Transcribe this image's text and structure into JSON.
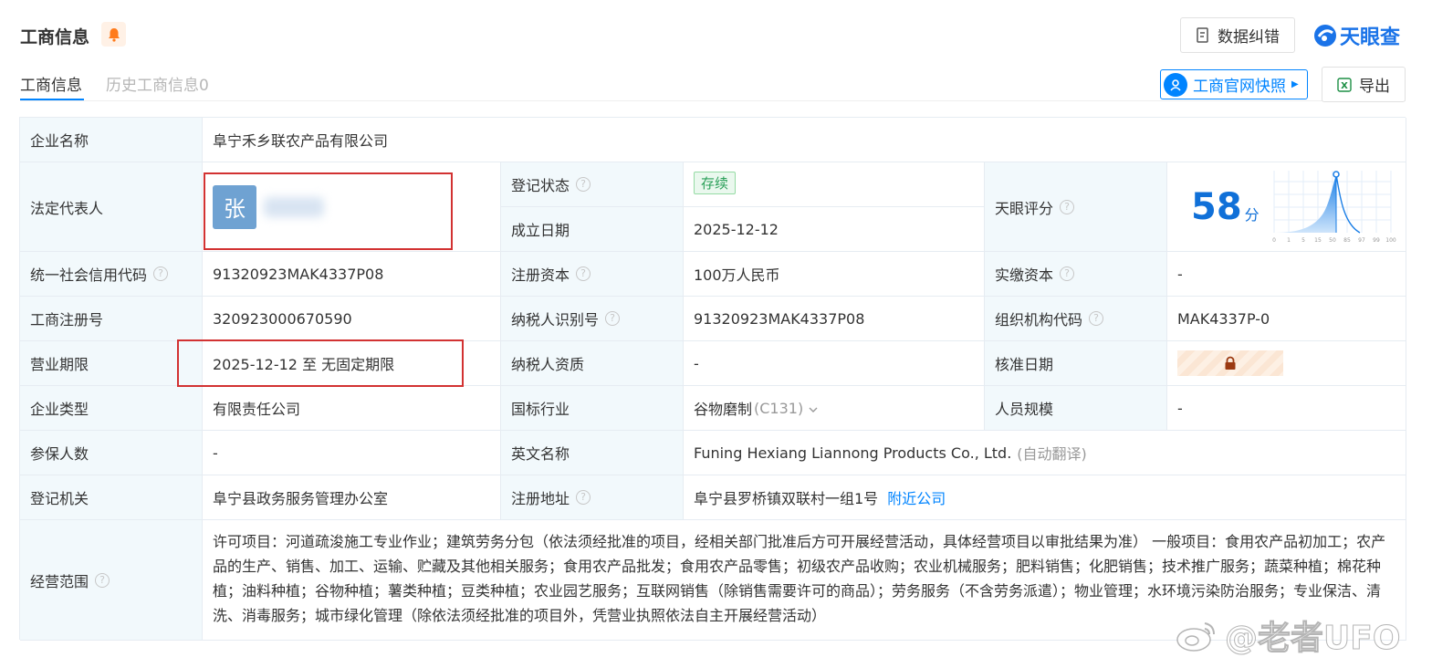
{
  "header": {
    "title": "工商信息",
    "correction_label": "数据纠错",
    "logo_text": "天眼查",
    "snapshot_label": "工商官网快照",
    "export_label": "导出",
    "bell_color": "#ff7a1a",
    "accent_color": "#0084ff"
  },
  "tabs": [
    {
      "label": "工商信息",
      "active": true
    },
    {
      "label": "历史工商信息0",
      "active": false
    }
  ],
  "table": {
    "company_name_label": "企业名称",
    "company_name": "阜宁禾乡联农产品有限公司",
    "legal_rep_label": "法定代表人",
    "legal_rep_avatar_char": "张",
    "reg_status_label": "登记状态",
    "reg_status": "存续",
    "founded_label": "成立日期",
    "founded": "2025-12-12",
    "score_label": "天眼评分",
    "score": "58",
    "score_unit": "分",
    "score_axis": [
      "0",
      "1",
      "5",
      "15",
      "50",
      "85",
      "97",
      "99",
      "100"
    ],
    "credit_code_label": "统一社会信用代码",
    "credit_code": "91320923MAK4337P08",
    "reg_capital_label": "注册资本",
    "reg_capital": "100万人民币",
    "paid_capital_label": "实缴资本",
    "paid_capital": "-",
    "biz_reg_no_label": "工商注册号",
    "biz_reg_no": "320923000670590",
    "taxpayer_id_label": "纳税人识别号",
    "taxpayer_id": "91320923MAK4337P08",
    "org_code_label": "组织机构代码",
    "org_code": "MAK4337P-0",
    "term_label": "营业期限",
    "term": "2025-12-12 至 无固定期限",
    "taxpayer_qual_label": "纳税人资质",
    "taxpayer_qual": "-",
    "approval_date_label": "核准日期",
    "company_type_label": "企业类型",
    "company_type": "有限责任公司",
    "industry_label": "国标行业",
    "industry": "谷物磨制",
    "industry_code": "(C131)",
    "staff_size_label": "人员规模",
    "staff_size": "-",
    "insured_label": "参保人数",
    "insured": "-",
    "english_name_label": "英文名称",
    "english_name": "Funing Hexiang Liannong Products Co., Ltd.",
    "auto_translate": "(自动翻译)",
    "reg_authority_label": "登记机关",
    "reg_authority": "阜宁县政务服务管理办公室",
    "reg_address_label": "注册地址",
    "reg_address": "阜宁县罗桥镇双联村一组1号",
    "nearby_link": "附近公司",
    "scope_label": "经营范围",
    "scope": "许可项目：河道疏浚施工专业作业；建筑劳务分包（依法须经批准的项目，经相关部门批准后方可开展经营活动，具体经营项目以审批结果为准） 一般项目：食用农产品初加工；农产品的生产、销售、加工、运输、贮藏及其他相关服务；食用农产品批发；食用农产品零售；初级农产品收购；农业机械服务；肥料销售；化肥销售；技术推广服务；蔬菜种植；棉花种植；油料种植；谷物种植；薯类种植；豆类种植；农业园艺服务；互联网销售（除销售需要许可的商品）；劳务服务（不含劳务派遣）；物业管理；水环境污染防治服务；专业保洁、清洗、消毒服务；城市绿化管理（除依法须经批准的项目外，凭营业执照依法自主开展经营活动）"
  },
  "watermark": "@老者UFO"
}
